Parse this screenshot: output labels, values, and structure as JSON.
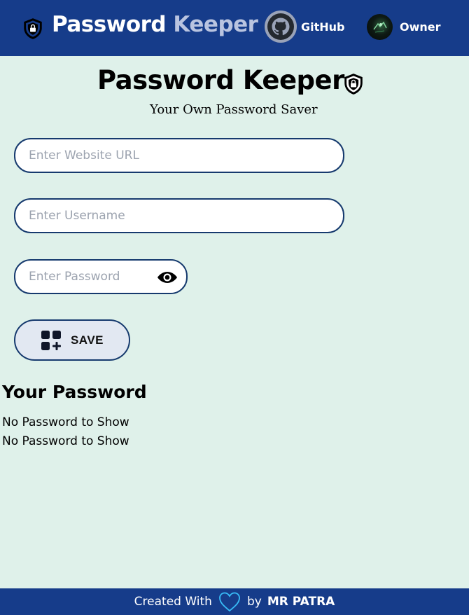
{
  "navbar": {
    "brand_part1": "Password",
    "brand_part2": "Keeper",
    "github_label": "GitHub",
    "owner_label": "Owner"
  },
  "header": {
    "title": "Password Keeper",
    "tagline": "Your Own Password Saver"
  },
  "form": {
    "url_placeholder": "Enter Website URL",
    "username_placeholder": "Enter Username",
    "password_placeholder": "Enter Password",
    "url_value": "",
    "username_value": "",
    "password_value": "",
    "save_label": "SAVE"
  },
  "passwords": {
    "title": "Your Password",
    "messages": [
      "No Password to Show",
      "No Password to Show"
    ]
  },
  "footer": {
    "prefix": "Created With",
    "by": "by",
    "author": "MR PATRA"
  },
  "colors": {
    "navbar_bg": "#163c8a",
    "page_bg": "#dff1ea",
    "border": "#163a6e",
    "heart": "#38bdf8"
  },
  "icons": {
    "brand": "shield-lock-icon",
    "github": "github-icon",
    "title": "shield-lock-icon",
    "password_toggle": "eye-icon",
    "save": "add-grid-icon",
    "footer": "heart-icon"
  }
}
